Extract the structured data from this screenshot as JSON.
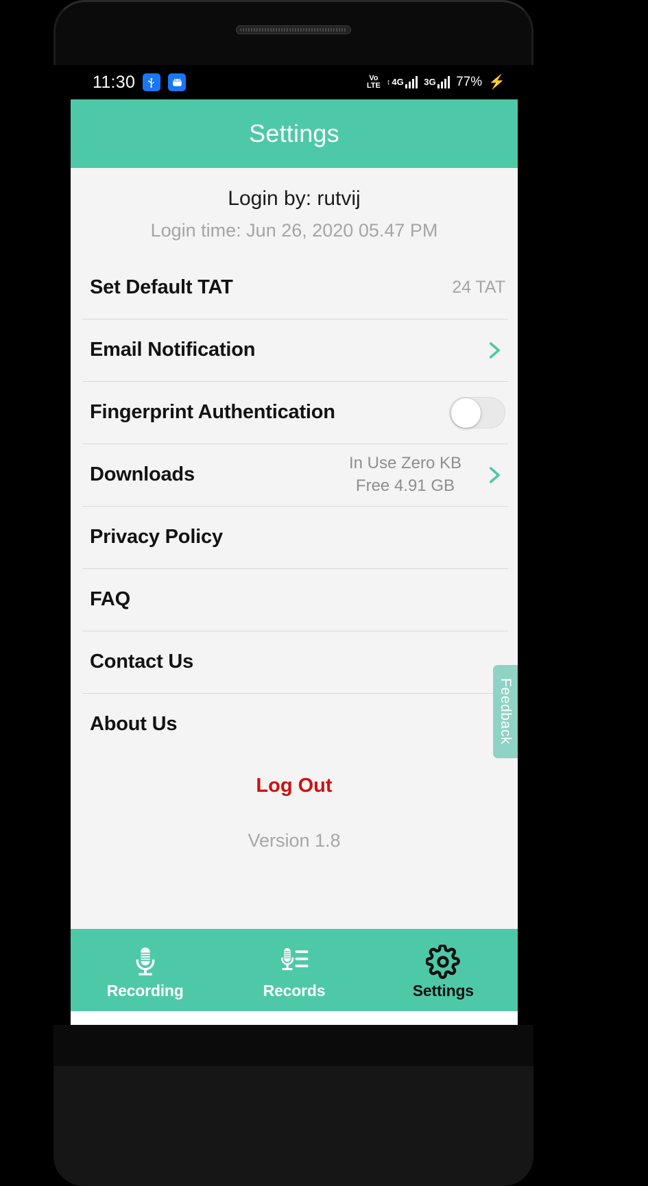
{
  "statusbar": {
    "clock": "11:30",
    "left_icons": [
      "usb-icon",
      "android-debug-icon"
    ],
    "volte_line1": "Vo",
    "volte_line2": "LTE",
    "net1_label": "4G",
    "net2_label": "3G",
    "battery": "77%",
    "charging_icon": "bolt-icon"
  },
  "appbar": {
    "title": "Settings"
  },
  "login": {
    "by": "Login by: rutvij",
    "time": "Login time: Jun 26, 2020 05.47 PM"
  },
  "rows": [
    {
      "label": "Set Default TAT",
      "value": "24 TAT",
      "accessory": "none"
    },
    {
      "label": "Email Notification",
      "value": "",
      "accessory": "chevron"
    },
    {
      "label": "Fingerprint Authentication",
      "value": "",
      "accessory": "toggle",
      "toggle_on": false
    },
    {
      "label": "Downloads",
      "value_line1": "In Use Zero KB",
      "value_line2": "Free 4.91 GB",
      "accessory": "chevron"
    },
    {
      "label": "Privacy Policy",
      "value": "",
      "accessory": "none"
    },
    {
      "label": "FAQ",
      "value": "",
      "accessory": "none"
    },
    {
      "label": "Contact Us",
      "value": "",
      "accessory": "none"
    },
    {
      "label": "About Us",
      "value": "",
      "accessory": "none"
    }
  ],
  "feedback": {
    "label": "Feedback"
  },
  "logout": {
    "label": "Log Out"
  },
  "version": {
    "label": "Version 1.8"
  },
  "tabbar": {
    "tabs": [
      {
        "label": "Recording",
        "icon": "microphone-icon",
        "active": false
      },
      {
        "label": "Records",
        "icon": "microphone-list-icon",
        "active": false
      },
      {
        "label": "Settings",
        "icon": "gear-icon",
        "active": true
      }
    ]
  },
  "navbar": {
    "buttons": [
      "menu-icon",
      "home-square-icon",
      "back-triangle-icon"
    ]
  },
  "colors": {
    "accent": "#4ec9a7",
    "accent_light": "#8ed3c3",
    "danger": "#cc1111",
    "page_bg": "#f4f4f4",
    "muted_text": "#a5a5a5"
  }
}
